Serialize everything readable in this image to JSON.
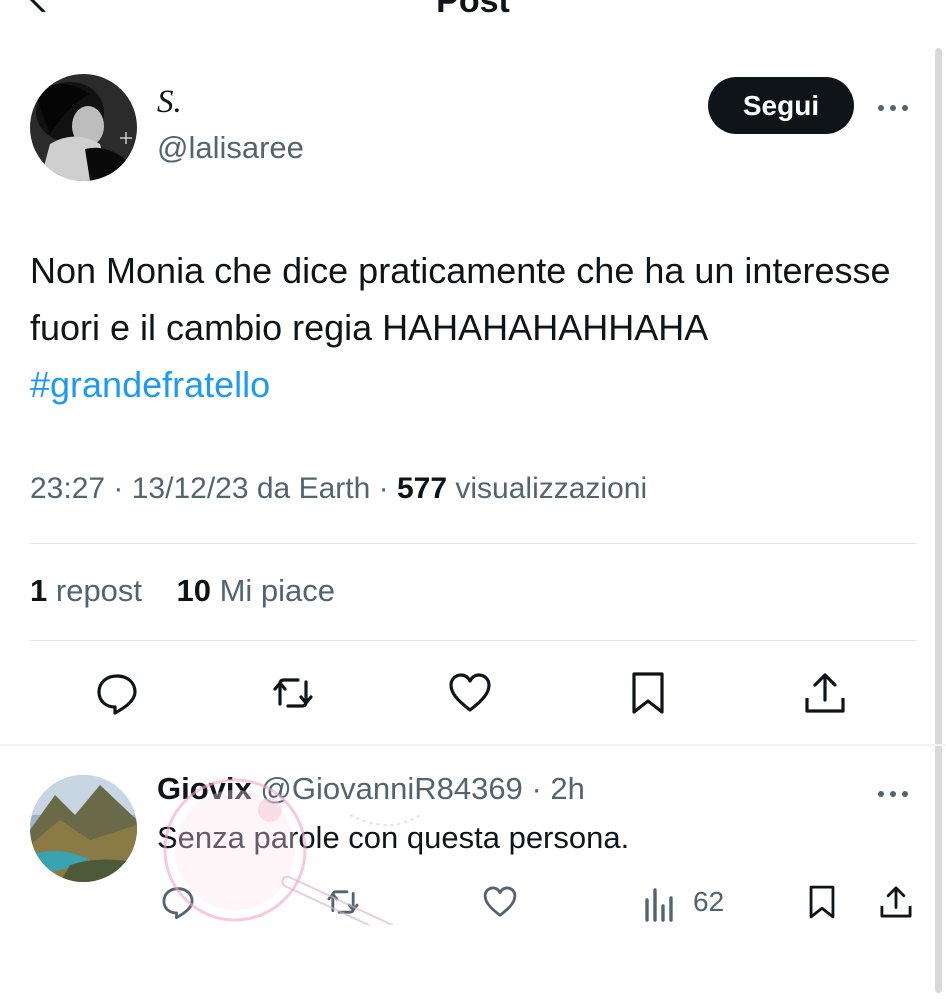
{
  "header": {
    "title": "Post"
  },
  "post": {
    "author_name": "S.",
    "author_handle": "@lalisaree",
    "follow_label": "Segui",
    "text_main": "Non Monia che dice praticamente che ha un interesse fuori e il cambio regia HAHAHAHAHHAHA",
    "hashtag": "#grandefratello",
    "time": "23:27",
    "date": "13/12/23",
    "source": "da Earth",
    "views_count": "577",
    "views_label": "visualizzazioni",
    "reposts_count": "1",
    "reposts_label": "repost",
    "likes_count": "10",
    "likes_label": "Mi piace"
  },
  "reply": {
    "name": "Giovix",
    "handle": "@GiovanniR84369",
    "time": "2h",
    "text": "Senza parole con questa persona.",
    "views": "62"
  },
  "colors": {
    "text": "#0f1419",
    "secondary": "#536471",
    "link": "#1d9bf0",
    "divider": "#e3e6e8",
    "button_bg": "#0f1419"
  },
  "icons": [
    "back-arrow-icon",
    "more-icon",
    "reply-icon",
    "repost-icon",
    "like-icon",
    "bookmark-icon",
    "share-icon",
    "views-icon"
  ]
}
